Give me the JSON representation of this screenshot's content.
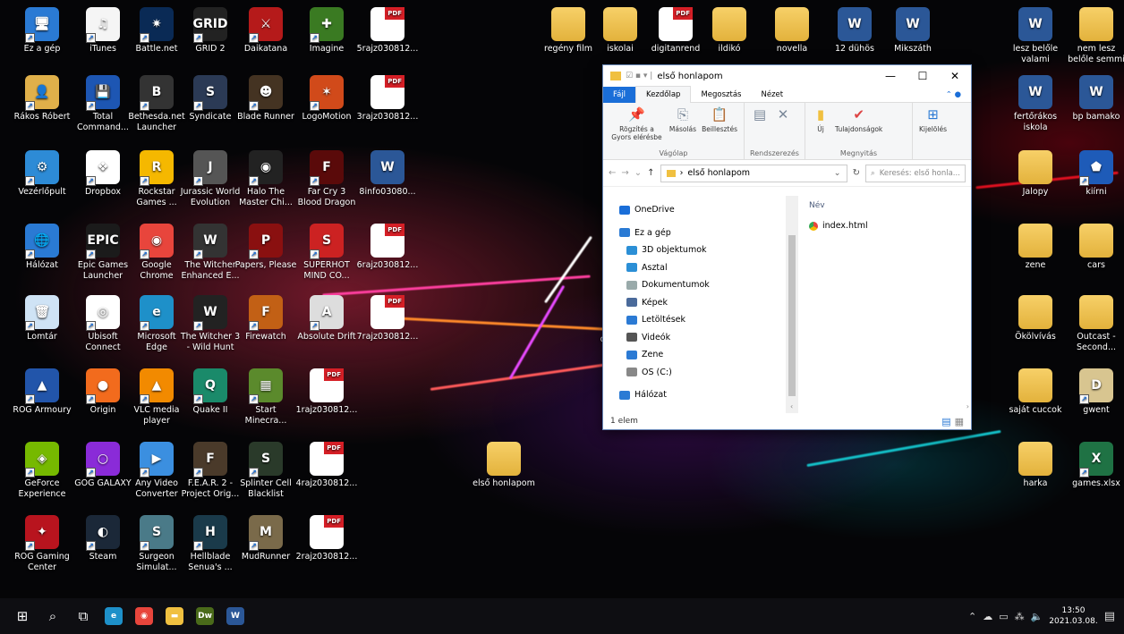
{
  "desktop": {
    "icons": [
      {
        "label": "Ez a gép",
        "glyph": "🖥",
        "bg": "#2a7ad4",
        "kind": ""
      },
      {
        "label": "iTunes",
        "glyph": "♫",
        "bg": "#f5f5f5",
        "kind": ""
      },
      {
        "label": "Battle.net",
        "glyph": "✷",
        "bg": "#0a2a55",
        "kind": ""
      },
      {
        "label": "GRID 2",
        "glyph": "GRID",
        "bg": "#222",
        "kind": ""
      },
      {
        "label": "Daikatana",
        "glyph": "⚔",
        "bg": "#b51a1a",
        "kind": ""
      },
      {
        "label": "Imagine",
        "glyph": "✚",
        "bg": "#3a7a22",
        "kind": ""
      },
      {
        "label": "5rajz030812...",
        "glyph": "",
        "bg": "",
        "kind": "pdf"
      },
      {
        "label": "regény film",
        "glyph": "",
        "bg": "",
        "kind": "folder"
      },
      {
        "label": "iskolai",
        "glyph": "",
        "bg": "",
        "kind": "folder"
      },
      {
        "label": "digitanrend",
        "glyph": "",
        "bg": "",
        "kind": "pdf"
      },
      {
        "label": "ildikó",
        "glyph": "",
        "bg": "",
        "kind": "folder"
      },
      {
        "label": "novella",
        "glyph": "",
        "bg": "",
        "kind": "folder"
      },
      {
        "label": "12 dühös",
        "glyph": "W",
        "bg": "",
        "kind": "word"
      },
      {
        "label": "Mikszáth",
        "glyph": "W",
        "bg": "",
        "kind": "word"
      },
      {
        "label": "lesz belőle valami",
        "glyph": "W",
        "bg": "",
        "kind": "word"
      },
      {
        "label": "nem lesz belőle semmi",
        "glyph": "",
        "bg": "",
        "kind": "folder"
      },
      {
        "label": "Rákos Róbert",
        "glyph": "👤",
        "bg": "#e0b04a",
        "kind": ""
      },
      {
        "label": "Total Command...",
        "glyph": "💾",
        "bg": "#1d56b3",
        "kind": ""
      },
      {
        "label": "Bethesda.net Launcher",
        "glyph": "B",
        "bg": "#333",
        "kind": ""
      },
      {
        "label": "Syndicate",
        "glyph": "S",
        "bg": "#2b3a55",
        "kind": ""
      },
      {
        "label": "Blade Runner",
        "glyph": "☻",
        "bg": "#443322",
        "kind": ""
      },
      {
        "label": "LogoMotion",
        "glyph": "✶",
        "bg": "#d14a1a",
        "kind": ""
      },
      {
        "label": "3rajz030812...",
        "glyph": "",
        "bg": "",
        "kind": "pdf"
      },
      {
        "label": "fertőrákos iskola",
        "glyph": "W",
        "bg": "",
        "kind": "word"
      },
      {
        "label": "bp bamako",
        "glyph": "W",
        "bg": "",
        "kind": "word"
      },
      {
        "label": "Vezérlőpult",
        "glyph": "⚙",
        "bg": "#2d8bd6",
        "kind": ""
      },
      {
        "label": "Dropbox",
        "glyph": "❖",
        "bg": "#fff",
        "kind": ""
      },
      {
        "label": "Rockstar Games ...",
        "glyph": "R",
        "bg": "#f5b800",
        "kind": ""
      },
      {
        "label": "Jurassic World Evolution",
        "glyph": "J",
        "bg": "#555",
        "kind": ""
      },
      {
        "label": "Halo The Master Chi...",
        "glyph": "◉",
        "bg": "#222",
        "kind": ""
      },
      {
        "label": "Far Cry 3 Blood Dragon",
        "glyph": "F",
        "bg": "#5a0a0a",
        "kind": ""
      },
      {
        "label": "8info03080...",
        "glyph": "W",
        "bg": "",
        "kind": "word"
      },
      {
        "label": "Jalopy",
        "glyph": "",
        "bg": "",
        "kind": "folder"
      },
      {
        "label": "kiírni",
        "glyph": "⬟",
        "bg": "#1e5bb8",
        "kind": ""
      },
      {
        "label": "Hálózat",
        "glyph": "🌐",
        "bg": "#2a7ad4",
        "kind": ""
      },
      {
        "label": "Epic Games Launcher",
        "glyph": "EPIC",
        "bg": "#1b1b1b",
        "kind": ""
      },
      {
        "label": "Google Chrome",
        "glyph": "◉",
        "bg": "#e8453c",
        "kind": ""
      },
      {
        "label": "The Witcher Enhanced E...",
        "glyph": "W",
        "bg": "#333",
        "kind": ""
      },
      {
        "label": "Papers, Please",
        "glyph": "P",
        "bg": "#8a1010",
        "kind": ""
      },
      {
        "label": "SUPERHOT MIND CO...",
        "glyph": "S",
        "bg": "#cc2222",
        "kind": ""
      },
      {
        "label": "6rajz030812...",
        "glyph": "",
        "bg": "",
        "kind": "pdf"
      },
      {
        "label": "zene",
        "glyph": "",
        "bg": "",
        "kind": "folder"
      },
      {
        "label": "cars",
        "glyph": "",
        "bg": "",
        "kind": "folder"
      },
      {
        "label": "Lomtár",
        "glyph": "🗑",
        "bg": "#cfe3f5",
        "kind": ""
      },
      {
        "label": "Ubisoft Connect",
        "glyph": "◎",
        "bg": "#fff",
        "kind": ""
      },
      {
        "label": "Microsoft Edge",
        "glyph": "e",
        "bg": "#1e90c9",
        "kind": ""
      },
      {
        "label": "The Witcher 3 - Wild Hunt",
        "glyph": "W",
        "bg": "#222",
        "kind": ""
      },
      {
        "label": "Firewatch",
        "glyph": "F",
        "bg": "#c26015",
        "kind": ""
      },
      {
        "label": "Absolute Drift",
        "glyph": "A",
        "bg": "#ddd",
        "kind": ""
      },
      {
        "label": "7rajz030812...",
        "glyph": "",
        "bg": "",
        "kind": "pdf"
      },
      {
        "label": "Ökölvívás",
        "glyph": "",
        "bg": "",
        "kind": "folder"
      },
      {
        "label": "Outcast - Second...",
        "glyph": "",
        "bg": "",
        "kind": "folder"
      },
      {
        "label": "ROG Armoury",
        "glyph": "▲",
        "bg": "#2255aa",
        "kind": ""
      },
      {
        "label": "Origin",
        "glyph": "●",
        "bg": "#f26b1d",
        "kind": ""
      },
      {
        "label": "VLC media player",
        "glyph": "▲",
        "bg": "#f28a00",
        "kind": ""
      },
      {
        "label": "Quake II",
        "glyph": "Q",
        "bg": "#1a8a6a",
        "kind": ""
      },
      {
        "label": "Start Minecra...",
        "glyph": "▦",
        "bg": "#5b8a2c",
        "kind": ""
      },
      {
        "label": "1rajz030812...",
        "glyph": "",
        "bg": "",
        "kind": "pdf"
      },
      {
        "label": "saját cuccok",
        "glyph": "",
        "bg": "",
        "kind": "folder"
      },
      {
        "label": "gwent",
        "glyph": "D",
        "bg": "#d8c590",
        "kind": ""
      },
      {
        "label": "GeForce Experience",
        "glyph": "◈",
        "bg": "#76b900",
        "kind": ""
      },
      {
        "label": "GOG GALAXY",
        "glyph": "○",
        "bg": "#8a2bd8",
        "kind": ""
      },
      {
        "label": "Any Video Converter",
        "glyph": "▶",
        "bg": "#3b8fe0",
        "kind": ""
      },
      {
        "label": "F.E.A.R. 2 - Project Orig...",
        "glyph": "F",
        "bg": "#4a3a2a",
        "kind": ""
      },
      {
        "label": "Splinter Cell Blacklist",
        "glyph": "S",
        "bg": "#2a3a2a",
        "kind": ""
      },
      {
        "label": "4rajz030812...",
        "glyph": "",
        "bg": "",
        "kind": "pdf"
      },
      {
        "label": "első honlapom",
        "glyph": "",
        "bg": "",
        "kind": "folder"
      },
      {
        "label": "harka",
        "glyph": "",
        "bg": "",
        "kind": "folder"
      },
      {
        "label": "games.xlsx",
        "glyph": "X",
        "bg": "#1f7244",
        "kind": ""
      },
      {
        "label": "ROG Gaming Center",
        "glyph": "✦",
        "bg": "#b8141e",
        "kind": ""
      },
      {
        "label": "Steam",
        "glyph": "◐",
        "bg": "#1b2838",
        "kind": ""
      },
      {
        "label": "Surgeon Simulat...",
        "glyph": "S",
        "bg": "#4a7a88",
        "kind": ""
      },
      {
        "label": "Hellblade Senua's ...",
        "glyph": "H",
        "bg": "#1a3a4a",
        "kind": ""
      },
      {
        "label": "MudRunner",
        "glyph": "M",
        "bg": "#7a6a4a",
        "kind": ""
      },
      {
        "label": "2rajz030812...",
        "glyph": "",
        "bg": "",
        "kind": "pdf"
      },
      {
        "label": "di",
        "glyph": "",
        "bg": "",
        "kind": "text"
      }
    ]
  },
  "explorer": {
    "title": "első honlapom",
    "tabs": [
      "Fájl",
      "Kezdőlap",
      "Megosztás",
      "Nézet"
    ],
    "ribbon_groups": [
      {
        "name": "Vágólap",
        "buttons": [
          "Rögzítés a Gyors elérésbe",
          "Másolás",
          "Beillesztés"
        ]
      },
      {
        "name": "Rendszerezés",
        "buttons": [
          "",
          "",
          ""
        ]
      },
      {
        "name": "Megnyitás",
        "buttons": [
          "Új",
          "Tulajdonságok"
        ]
      },
      {
        "name": "",
        "buttons": [
          "Kijelölés"
        ]
      }
    ],
    "address": "első honlapom",
    "search_placeholder": "Keresés: első honla...",
    "nav_items": [
      {
        "label": "OneDrive",
        "color": "#1a6ed8",
        "indent": 0
      },
      {
        "label": "Ez a gép",
        "color": "#2a7ad4",
        "indent": 0
      },
      {
        "label": "3D objektumok",
        "color": "#2b8fd6",
        "indent": 1
      },
      {
        "label": "Asztal",
        "color": "#2b8fd6",
        "indent": 1
      },
      {
        "label": "Dokumentumok",
        "color": "#9aa",
        "indent": 1
      },
      {
        "label": "Képek",
        "color": "#4a6a9a",
        "indent": 1
      },
      {
        "label": "Letöltések",
        "color": "#2b7ad4",
        "indent": 1
      },
      {
        "label": "Videók",
        "color": "#555",
        "indent": 1
      },
      {
        "label": "Zene",
        "color": "#2b7ad4",
        "indent": 1
      },
      {
        "label": "OS (C:)",
        "color": "#888",
        "indent": 1
      },
      {
        "label": "Hálózat",
        "color": "#2a7ad4",
        "indent": 0
      }
    ],
    "column_header": "Név",
    "files": [
      {
        "name": "index.html"
      }
    ],
    "status": "1 elem"
  },
  "taskbar": {
    "apps": [
      {
        "name": "start",
        "glyph": "⊞"
      },
      {
        "name": "search",
        "glyph": "⌕"
      },
      {
        "name": "task-view",
        "glyph": "⧉"
      },
      {
        "name": "edge",
        "glyph": "e",
        "bg": "#1e90c9"
      },
      {
        "name": "chrome",
        "glyph": "◉",
        "bg": "#e8453c"
      },
      {
        "name": "file-explorer",
        "glyph": "▬",
        "bg": "#f0c040"
      },
      {
        "name": "dreamweaver",
        "glyph": "Dw",
        "bg": "#4a6a1a"
      },
      {
        "name": "word",
        "glyph": "W",
        "bg": "#2b5797"
      }
    ],
    "time": "13:50",
    "date": "2021.03.08."
  }
}
